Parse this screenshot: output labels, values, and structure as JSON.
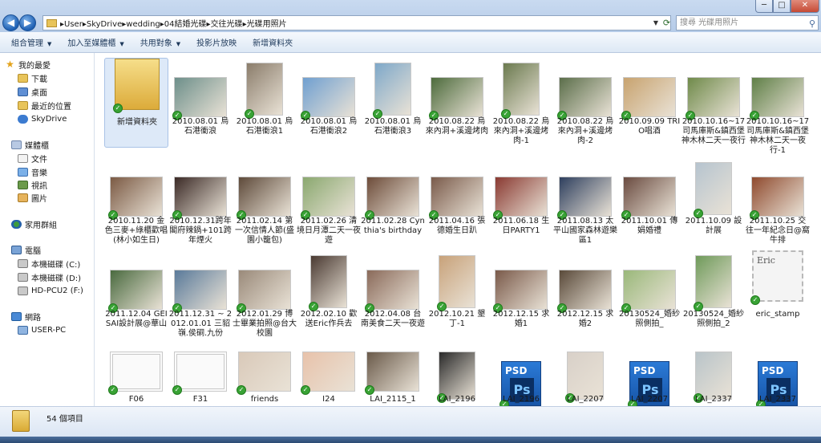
{
  "window": {
    "controls": {
      "minimize": "─",
      "maximize": "□",
      "close": "✕"
    }
  },
  "address_bar": {
    "crumbs": [
      "User",
      "SkyDrive",
      "wedding",
      "04結婚光碟",
      "交往光碟",
      "光碟用照片"
    ]
  },
  "search": {
    "placeholder": "搜尋 光碟用照片"
  },
  "toolbar": {
    "organize": "組合管理",
    "add_to_library": "加入至媒體櫃",
    "share": "共用對象",
    "slideshow": "投影片放映",
    "new_folder": "新增資料夾"
  },
  "nav": {
    "favorites": "我的最愛",
    "downloads": "下載",
    "desktop": "桌面",
    "recent": "最近的位置",
    "skydrive": "SkyDrive",
    "libraries": "媒體櫃",
    "documents": "文件",
    "music": "音樂",
    "videos": "視訊",
    "pictures": "圖片",
    "homegroup": "家用群組",
    "computer": "電腦",
    "drive_c": "本機磁碟 (C:)",
    "drive_d": "本機磁碟 (D:)",
    "drive_f": "HD-PCU2 (F:)",
    "network": "網路",
    "user_pc": "USER-PC"
  },
  "files": [
    {
      "label": "新增資料夾",
      "kind": "folder"
    },
    {
      "label": "2010.08.01 烏石港衝浪",
      "kind": "photo",
      "color": "#6d8f8a"
    },
    {
      "label": "2010.08.01 烏石港衝浪1",
      "kind": "photo",
      "color": "#8b7d6b"
    },
    {
      "label": "2010.08.01 烏石港衝浪2",
      "kind": "photo",
      "color": "#6f9fd0"
    },
    {
      "label": "2010.08.01 烏石港衝浪3",
      "kind": "photo",
      "color": "#7ea8c9"
    },
    {
      "label": "2010.08.22 烏來內洞+溪邊烤肉",
      "kind": "photo",
      "color": "#4d6b3c"
    },
    {
      "label": "2010.08.22 烏來內洞+溪邊烤肉-1",
      "kind": "photo",
      "color": "#6b7a4f"
    },
    {
      "label": "2010.08.22 烏來內洞+溪邊烤肉-2",
      "kind": "photo",
      "color": "#5b6e4a"
    },
    {
      "label": "2010.09.09 TRIO唱酒",
      "kind": "photo",
      "color": "#c8a36f"
    },
    {
      "label": "2010.10.16~17 司馬庫斯&鎮西堡神木林二天一夜行",
      "kind": "photo",
      "color": "#6f8a4a"
    },
    {
      "label": "2010.10.16~17 司馬庫斯&鎮西堡神木林二天一夜行-1",
      "kind": "photo",
      "color": "#5f7f47"
    },
    {
      "label": "2010.11.20 金色三麥+綠櫃歡唱(林小如生日)",
      "kind": "photo",
      "color": "#7b5a44"
    },
    {
      "label": "2010.12.31跨年閣府辣鍋+101跨年煙火",
      "kind": "photo",
      "color": "#3b2a26"
    },
    {
      "label": "2011.02.14 第一次信情人節(盛園小籠包)",
      "kind": "photo",
      "color": "#5e4a3a"
    },
    {
      "label": "2011.02.26 清境日月潭二天一夜遊",
      "kind": "photo",
      "color": "#8aa86f"
    },
    {
      "label": "2011.02.28 Cynthia's birthday",
      "kind": "photo",
      "color": "#6d4c3a"
    },
    {
      "label": "2011.04.16 張德婚生日趴",
      "kind": "photo",
      "color": "#7a5b4b"
    },
    {
      "label": "2011.06.18 生日PARTY1",
      "kind": "photo",
      "color": "#8a3a32"
    },
    {
      "label": "2011.08.13 太平山國家森林遊樂區1",
      "kind": "photo",
      "color": "#2e3f5e"
    },
    {
      "label": "2011.10.01 傳娟婚禮",
      "kind": "photo",
      "color": "#6a4b40"
    },
    {
      "label": "2011.10.09 設計展",
      "kind": "photo",
      "color": "#b6c4cf"
    },
    {
      "label": "2011.10.25 交往一年紀念日@窩牛排",
      "kind": "photo",
      "color": "#8f4a2e"
    },
    {
      "label": "2011.12.04 GEISAI設計展@華山",
      "kind": "photo",
      "color": "#4a6a3f"
    },
    {
      "label": "2011.12.31 ~ 2012.01.01 三貂嶺.侯硐.九份",
      "kind": "photo",
      "color": "#5a7a9a"
    },
    {
      "label": "2012.01.29 博士畢業拍照@台大校園",
      "kind": "photo",
      "color": "#9a8a7a"
    },
    {
      "label": "2012.02.10 歡送Eric作兵去",
      "kind": "photo",
      "color": "#4a3a32"
    },
    {
      "label": "2012.04.08 台南美食二天一夜遊",
      "kind": "photo",
      "color": "#8a6a5a"
    },
    {
      "label": "2012.10.21 墾丁-1",
      "kind": "photo",
      "color": "#c8a27a"
    },
    {
      "label": "2012.12.15 求婚1",
      "kind": "photo",
      "color": "#7a5a4a"
    },
    {
      "label": "2012.12.15 求婚2",
      "kind": "photo",
      "color": "#5a4a3a"
    },
    {
      "label": "20130524_婚紗照側拍_",
      "kind": "photo",
      "color": "#9ab87a"
    },
    {
      "label": "20130524_婚紗照側拍_2",
      "kind": "photo",
      "color": "#6f9a5a"
    },
    {
      "label": "eric_stamp",
      "kind": "stamp",
      "stamp_text": "Eric"
    },
    {
      "label": "F06",
      "kind": "frame"
    },
    {
      "label": "F31",
      "kind": "frame"
    },
    {
      "label": "friends",
      "kind": "photo",
      "color": "#d9c9b9"
    },
    {
      "label": "I24",
      "kind": "photo",
      "color": "#e8c2aa"
    },
    {
      "label": "LAI_2115_1",
      "kind": "photo",
      "color": "#6a5a4a"
    },
    {
      "label": "LAI_2196",
      "kind": "photo",
      "color": "#2a2a2a"
    },
    {
      "label": "LAI_2196",
      "kind": "psd",
      "badge": "PSD",
      "logo": "Ps"
    },
    {
      "label": "LAI_2207",
      "kind": "photo",
      "color": "#d8d0c8"
    },
    {
      "label": "LAI_2207",
      "kind": "psd",
      "badge": "PSD",
      "logo": "Ps"
    },
    {
      "label": "LAI_2337",
      "kind": "photo",
      "color": "#b9c4c9"
    },
    {
      "label": "LAI_2337",
      "kind": "psd",
      "badge": "PSD",
      "logo": "Ps"
    }
  ],
  "status": {
    "item_count": "54 個項目"
  }
}
